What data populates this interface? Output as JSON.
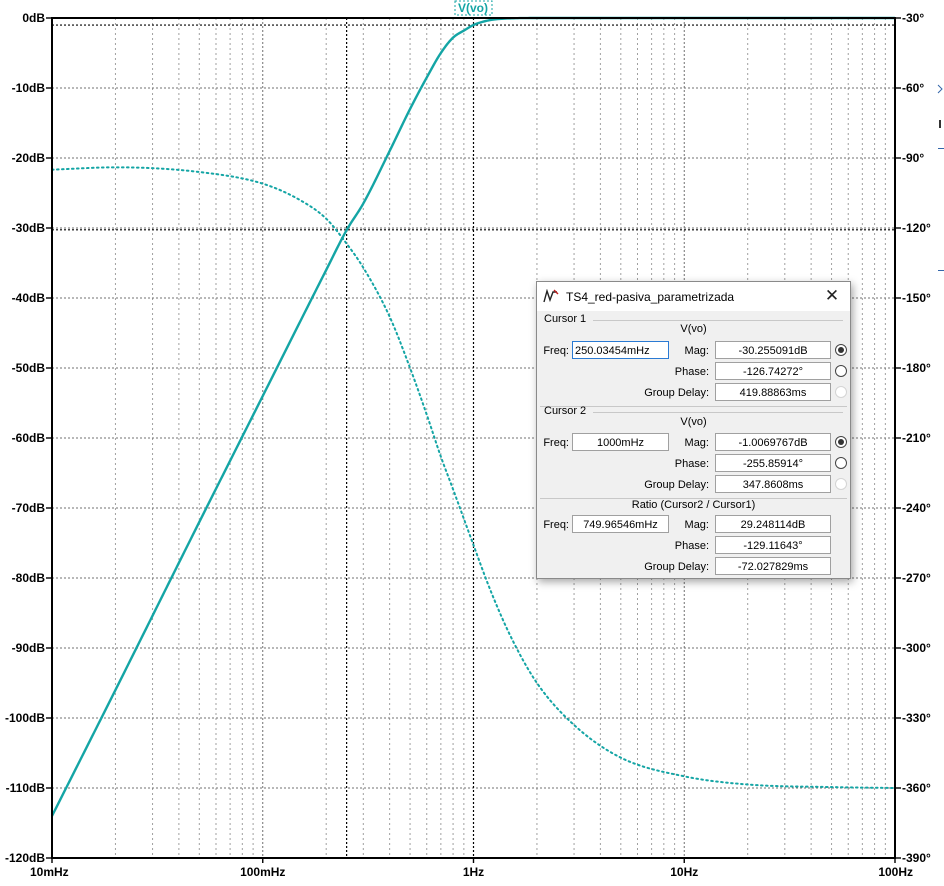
{
  "chart_data": {
    "type": "line",
    "trace_label": "V(vo)",
    "x_axis": {
      "scale": "log",
      "range": [
        0.01,
        100
      ],
      "unit": "Hz",
      "ticks": [
        {
          "value": 0.01,
          "label": "10mHz"
        },
        {
          "value": 0.1,
          "label": "100mHz"
        },
        {
          "value": 1,
          "label": "1Hz"
        },
        {
          "value": 10,
          "label": "10Hz"
        },
        {
          "value": 100,
          "label": "100Hz"
        }
      ]
    },
    "y_left": {
      "range": [
        -120,
        0
      ],
      "ticks": [
        {
          "value": 0,
          "label": "0dB"
        },
        {
          "value": -10,
          "label": "-10dB"
        },
        {
          "value": -20,
          "label": "-20dB"
        },
        {
          "value": -30,
          "label": "-30dB"
        },
        {
          "value": -40,
          "label": "-40dB"
        },
        {
          "value": -50,
          "label": "-50dB"
        },
        {
          "value": -60,
          "label": "-60dB"
        },
        {
          "value": -70,
          "label": "-70dB"
        },
        {
          "value": -80,
          "label": "-80dB"
        },
        {
          "value": -90,
          "label": "-90dB"
        },
        {
          "value": -100,
          "label": "-100dB"
        },
        {
          "value": -110,
          "label": "-110dB"
        },
        {
          "value": -120,
          "label": "-120dB"
        }
      ]
    },
    "y_right": {
      "range": [
        -390,
        -30
      ],
      "ticks": [
        {
          "value": -30,
          "label": "-30°"
        },
        {
          "value": -60,
          "label": "-60°"
        },
        {
          "value": -90,
          "label": "-90°"
        },
        {
          "value": -120,
          "label": "-120°"
        },
        {
          "value": -150,
          "label": "-150°"
        },
        {
          "value": -180,
          "label": "-180°"
        },
        {
          "value": -210,
          "label": "-210°"
        },
        {
          "value": -240,
          "label": "-240°"
        },
        {
          "value": -270,
          "label": "-270°"
        },
        {
          "value": -300,
          "label": "-300°"
        },
        {
          "value": -330,
          "label": "-330°"
        },
        {
          "value": -360,
          "label": "-360°"
        },
        {
          "value": -390,
          "label": "-390°"
        }
      ]
    },
    "grid": true,
    "cursors": [
      {
        "x": 0.25,
        "y": -30.26
      },
      {
        "x": 1.0,
        "y": -1.01
      }
    ],
    "series": [
      {
        "quantity": "magnitude",
        "axis": "left",
        "style": "solid",
        "color": "#14a5a5",
        "x": [
          0.01,
          0.02,
          0.05,
          0.1,
          0.2,
          0.25,
          0.3,
          0.4,
          0.5,
          0.6,
          0.7,
          0.8,
          0.9,
          1.0,
          1.2,
          1.5,
          2,
          5,
          10,
          100
        ],
        "y": [
          -114,
          -96,
          -72,
          -54,
          -36,
          -30.3,
          -26.5,
          -19,
          -13,
          -8.5,
          -5,
          -2.8,
          -1.8,
          -1.0,
          -0.3,
          -0.05,
          0,
          0,
          0,
          0
        ]
      },
      {
        "quantity": "phase",
        "axis": "right",
        "style": "dotted",
        "color": "#14a5a5",
        "x": [
          0.01,
          0.02,
          0.05,
          0.1,
          0.15,
          0.2,
          0.25,
          0.3,
          0.4,
          0.5,
          0.6,
          0.7,
          0.8,
          1.0,
          1.2,
          1.5,
          2,
          3,
          5,
          10,
          20,
          50,
          100
        ],
        "y": [
          -95,
          -94,
          -96,
          -101,
          -108,
          -116,
          -126.7,
          -137,
          -158,
          -180,
          -200,
          -218,
          -232,
          -255.9,
          -275,
          -295,
          -315,
          -333,
          -347,
          -355,
          -358.5,
          -359.6,
          -360
        ]
      }
    ]
  },
  "dialog": {
    "title": "TS4_red-pasiva_parametrizada",
    "cursor1": {
      "heading": "Cursor 1",
      "trace": "V(vo)",
      "freq_label": "Freq:",
      "freq": "250.03454mHz",
      "mag_label": "Mag:",
      "mag": "-30.255091dB",
      "phase_label": "Phase:",
      "phase": "-126.74272°",
      "gd_label": "Group Delay:",
      "gd": "419.88863ms"
    },
    "cursor2": {
      "heading": "Cursor 2",
      "trace": "V(vo)",
      "freq_label": "Freq:",
      "freq": "1000mHz",
      "mag_label": "Mag:",
      "mag": "-1.0069767dB",
      "phase_label": "Phase:",
      "phase": "-255.85914°",
      "gd_label": "Group Delay:",
      "gd": "347.8608ms"
    },
    "ratio": {
      "heading": "Ratio (Cursor2 / Cursor1)",
      "freq_label": "Freq:",
      "freq": "749.96546mHz",
      "mag_label": "Mag:",
      "mag": "29.248114dB",
      "phase_label": "Phase:",
      "phase": "-129.11643°",
      "gd_label": "Group Delay:",
      "gd": "-72.027829ms"
    },
    "colors": {
      "trace": "#14a5a5",
      "active_field_border": "#2a7ad3"
    }
  }
}
